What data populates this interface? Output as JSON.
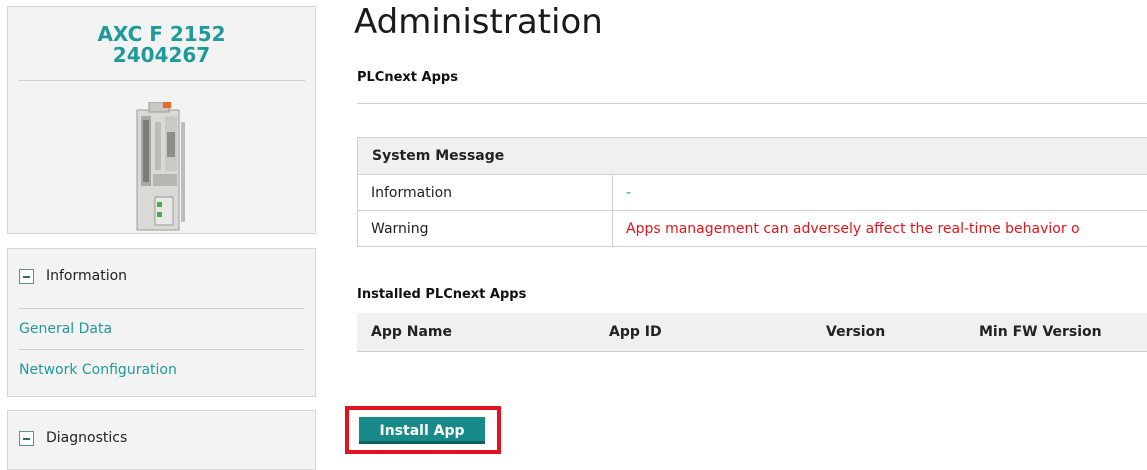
{
  "device": {
    "model": "AXC F 2152",
    "article_number": "2404267",
    "image": "plc-controller-image"
  },
  "sidebar": {
    "information": {
      "label": "Information",
      "icon": "collapse-icon",
      "links": [
        "General Data",
        "Network Configuration"
      ]
    },
    "diagnostics": {
      "label": "Diagnostics",
      "icon": "collapse-icon"
    }
  },
  "page": {
    "title": "Administration",
    "section": "PLCnext Apps"
  },
  "system_message": {
    "header": "System Message",
    "rows": [
      {
        "label": "Information",
        "value": "-"
      },
      {
        "label": "Warning",
        "value": "Apps management can adversely affect the real-time behavior o"
      }
    ]
  },
  "installed_apps": {
    "title": "Installed PLCnext Apps",
    "columns": [
      "App Name",
      "App ID",
      "Version",
      "Min FW Version"
    ]
  },
  "actions": {
    "install_label": "Install App"
  },
  "colors": {
    "accent": "#1f9a9a",
    "button": "#188a8a",
    "warning": "#e3151c",
    "highlight": "#e0141e"
  }
}
